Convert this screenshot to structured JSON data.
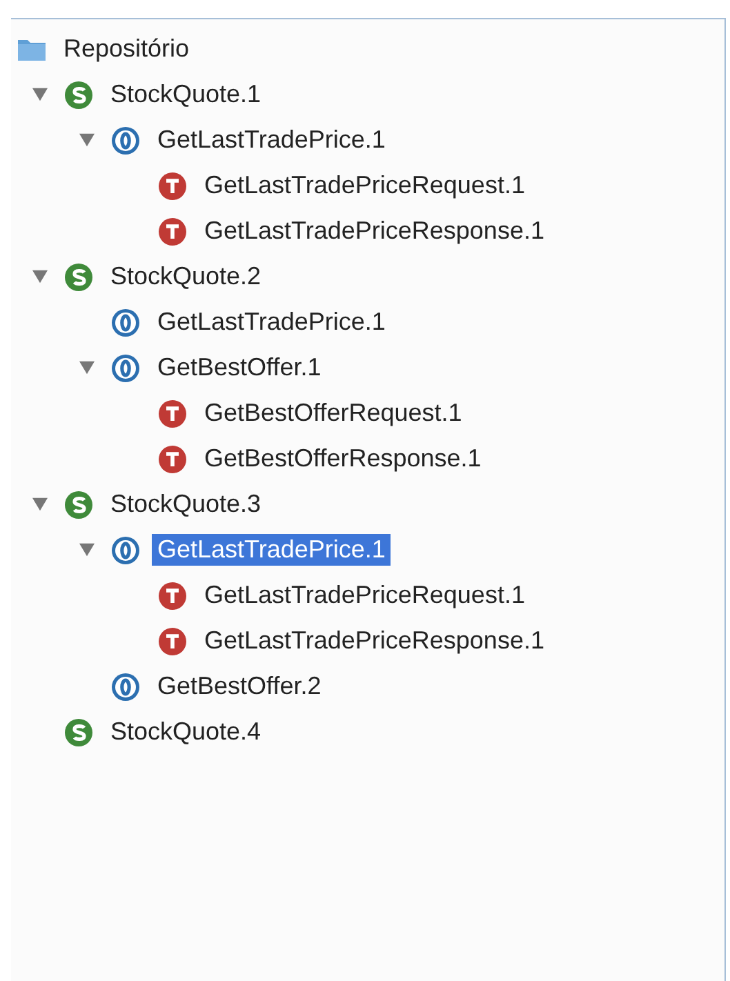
{
  "tree": {
    "kind": "folder",
    "label": "Repositório",
    "selected": false,
    "children": [
      {
        "kind": "service",
        "label": "StockQuote.1",
        "expanded": true,
        "selected": false,
        "children": [
          {
            "kind": "operation",
            "label": "GetLastTradePrice.1",
            "expanded": true,
            "selected": false,
            "children": [
              {
                "kind": "type",
                "label": "GetLastTradePriceRequest.1",
                "selected": false
              },
              {
                "kind": "type",
                "label": "GetLastTradePriceResponse.1",
                "selected": false
              }
            ]
          }
        ]
      },
      {
        "kind": "service",
        "label": "StockQuote.2",
        "expanded": true,
        "selected": false,
        "children": [
          {
            "kind": "operation",
            "label": "GetLastTradePrice.1",
            "selected": false
          },
          {
            "kind": "operation",
            "label": "GetBestOffer.1",
            "expanded": true,
            "selected": false,
            "children": [
              {
                "kind": "type",
                "label": "GetBestOfferRequest.1",
                "selected": false
              },
              {
                "kind": "type",
                "label": "GetBestOfferResponse.1",
                "selected": false
              }
            ]
          }
        ]
      },
      {
        "kind": "service",
        "label": "StockQuote.3",
        "expanded": true,
        "selected": false,
        "children": [
          {
            "kind": "operation",
            "label": "GetLastTradePrice.1",
            "expanded": true,
            "selected": true,
            "children": [
              {
                "kind": "type",
                "label": "GetLastTradePriceRequest.1",
                "selected": false
              },
              {
                "kind": "type",
                "label": "GetLastTradePriceResponse.1",
                "selected": false
              }
            ]
          },
          {
            "kind": "operation",
            "label": "GetBestOffer.2",
            "selected": false
          }
        ]
      },
      {
        "kind": "service",
        "label": "StockQuote.4",
        "selected": false
      }
    ]
  }
}
